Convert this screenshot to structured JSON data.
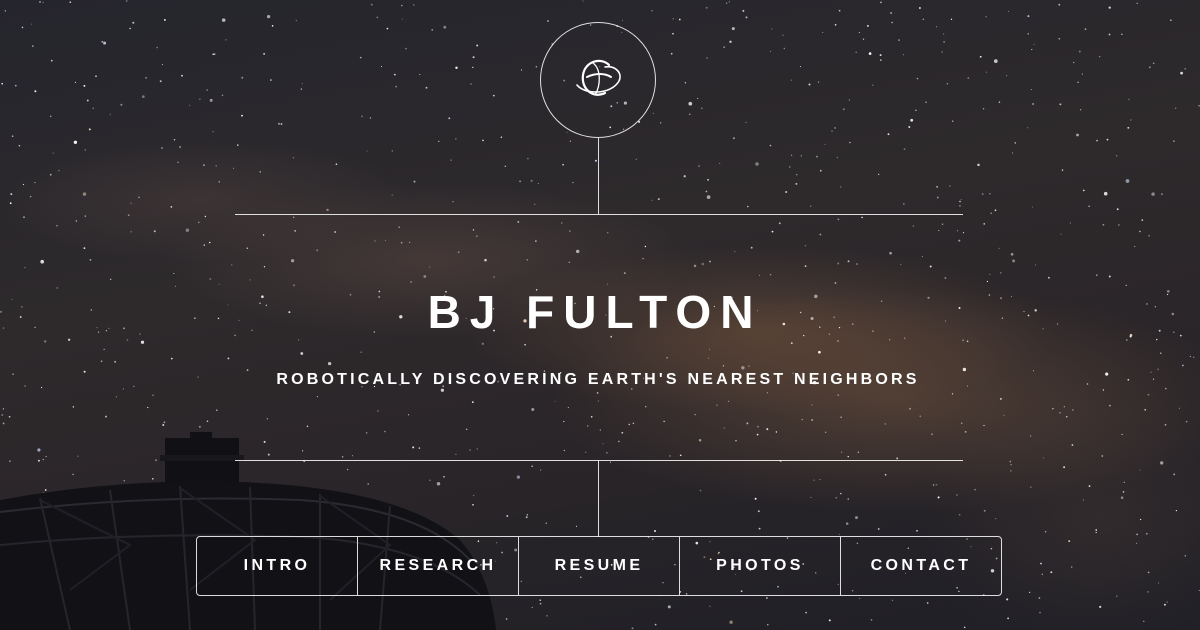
{
  "header": {
    "logo_icon": "stylized-e-orbit-icon",
    "title": "BJ FULTON",
    "tagline": "ROBOTICALLY DISCOVERING EARTH'S NEAREST NEIGHBORS"
  },
  "nav": {
    "items": [
      {
        "label": "INTRO"
      },
      {
        "label": "RESEARCH"
      },
      {
        "label": "RESUME"
      },
      {
        "label": "PHOTOS"
      },
      {
        "label": "CONTACT"
      }
    ]
  },
  "colors": {
    "text": "#ffffff",
    "lines": "#ffffff",
    "background": "#25252d"
  }
}
